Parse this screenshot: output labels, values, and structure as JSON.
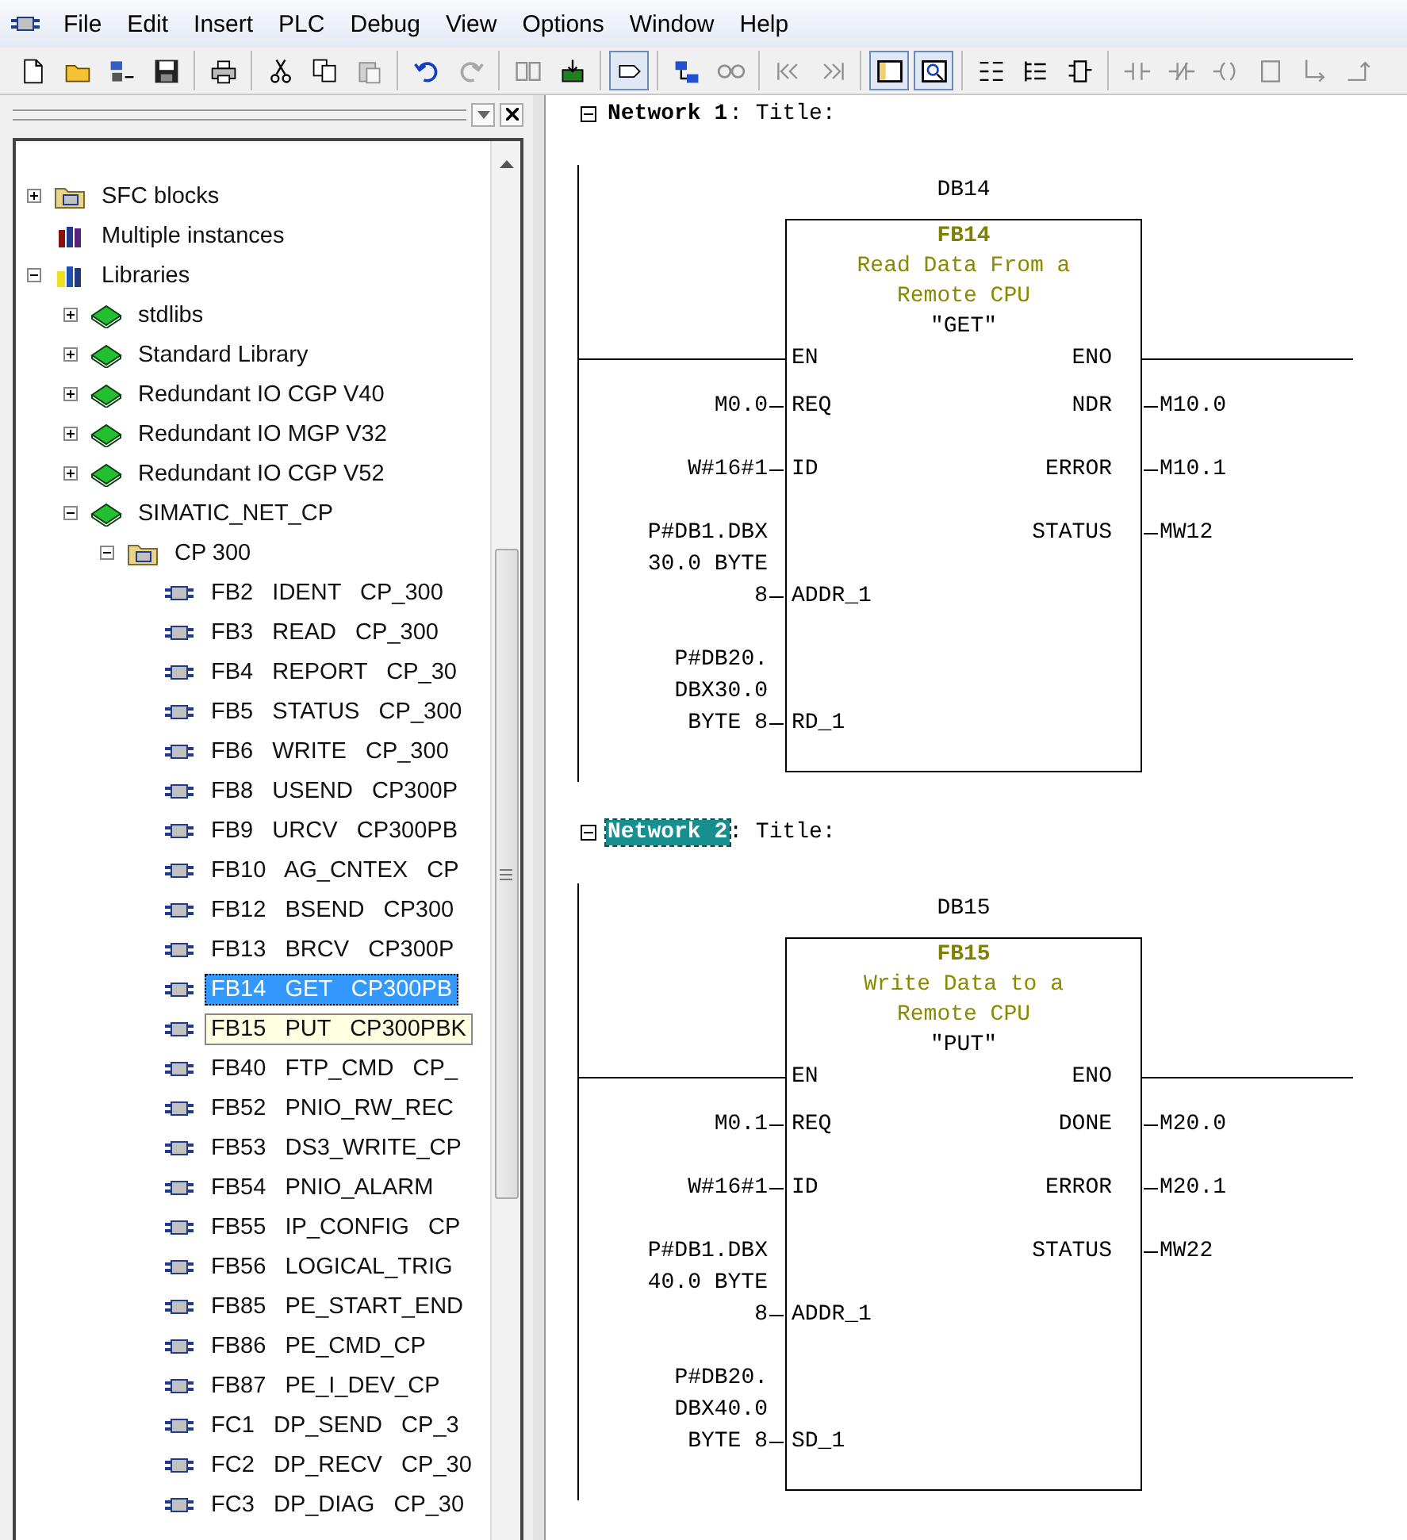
{
  "menu_bar": {
    "items": [
      "File",
      "Edit",
      "Insert",
      "PLC",
      "Debug",
      "View",
      "Options",
      "Window",
      "Help"
    ]
  },
  "toolbar": {
    "groups": [
      [
        {
          "kind": "new",
          "disabled": false,
          "pressed": false
        },
        {
          "kind": "open",
          "disabled": false,
          "pressed": false
        },
        {
          "kind": "nodes",
          "disabled": false,
          "pressed": false
        },
        {
          "kind": "save",
          "disabled": false,
          "pressed": false
        }
      ],
      [
        {
          "kind": "print",
          "disabled": false,
          "pressed": false
        }
      ],
      [
        {
          "kind": "cut",
          "disabled": false,
          "pressed": false
        },
        {
          "kind": "copy",
          "disabled": false,
          "pressed": false
        },
        {
          "kind": "paste",
          "disabled": true,
          "pressed": false
        }
      ],
      [
        {
          "kind": "undo",
          "disabled": false,
          "pressed": false
        },
        {
          "kind": "redo",
          "disabled": true,
          "pressed": false
        }
      ],
      [
        {
          "kind": "compile",
          "disabled": true,
          "pressed": false
        },
        {
          "kind": "download",
          "disabled": false,
          "pressed": false
        }
      ],
      [
        {
          "kind": "monitor",
          "disabled": false,
          "pressed": true
        }
      ],
      [
        {
          "kind": "network",
          "disabled": false,
          "pressed": false
        },
        {
          "kind": "glasses",
          "disabled": true,
          "pressed": false
        }
      ],
      [
        {
          "kind": "prev",
          "disabled": true,
          "pressed": false
        },
        {
          "kind": "next",
          "disabled": true,
          "pressed": false
        }
      ],
      [
        {
          "kind": "overview",
          "disabled": false,
          "pressed": true
        },
        {
          "kind": "details",
          "disabled": false,
          "pressed": true
        }
      ],
      [
        {
          "kind": "ladder",
          "disabled": false,
          "pressed": false
        },
        {
          "kind": "stl",
          "disabled": false,
          "pressed": false
        },
        {
          "kind": "fbd",
          "disabled": false,
          "pressed": false
        }
      ],
      [
        {
          "kind": "contact_no",
          "disabled": true,
          "pressed": false
        },
        {
          "kind": "contact_nc",
          "disabled": true,
          "pressed": false
        },
        {
          "kind": "coil",
          "disabled": true,
          "pressed": false
        },
        {
          "kind": "box",
          "disabled": true,
          "pressed": false
        },
        {
          "kind": "branch_open",
          "disabled": true,
          "pressed": false
        },
        {
          "kind": "branch_close",
          "disabled": true,
          "pressed": false
        }
      ]
    ]
  },
  "tree": {
    "items": [
      {
        "label": "SFC blocks",
        "kind": "folder",
        "expanded": false,
        "selected": false
      },
      {
        "label": "Multiple instances",
        "kind": "instances",
        "selected": false
      },
      {
        "label": "Libraries",
        "kind": "libraries",
        "expanded": true,
        "selected": false,
        "children": [
          {
            "label": "stdlibs",
            "kind": "library",
            "expanded": false,
            "selected": false
          },
          {
            "label": "Standard Library",
            "kind": "library",
            "expanded": false,
            "selected": false
          },
          {
            "label": "Redundant IO CGP V40",
            "kind": "library",
            "expanded": false,
            "selected": false
          },
          {
            "label": "Redundant IO MGP V32",
            "kind": "library",
            "expanded": false,
            "selected": false
          },
          {
            "label": "Redundant IO CGP V52",
            "kind": "library",
            "expanded": false,
            "selected": false
          },
          {
            "label": "SIMATIC_NET_CP",
            "kind": "library",
            "expanded": true,
            "selected": false,
            "children": [
              {
                "label": "CP 300",
                "kind": "folder",
                "expanded": true,
                "selected": false,
                "children": [
                  {
                    "label": "FB2   IDENT   CP_300",
                    "kind": "block",
                    "selected": false
                  },
                  {
                    "label": "FB3   READ   CP_300",
                    "kind": "block",
                    "selected": false
                  },
                  {
                    "label": "FB4   REPORT   CP_30",
                    "kind": "block",
                    "selected": false
                  },
                  {
                    "label": "FB5   STATUS   CP_300",
                    "kind": "block",
                    "selected": false
                  },
                  {
                    "label": "FB6   WRITE   CP_300",
                    "kind": "block",
                    "selected": false
                  },
                  {
                    "label": "FB8   USEND   CP300P",
                    "kind": "block",
                    "selected": false
                  },
                  {
                    "label": "FB9   URCV   CP300PB",
                    "kind": "block",
                    "selected": false
                  },
                  {
                    "label": "FB10   AG_CNTEX   CP",
                    "kind": "block",
                    "selected": false
                  },
                  {
                    "label": "FB12   BSEND   CP300",
                    "kind": "block",
                    "selected": false
                  },
                  {
                    "label": "FB13   BRCV   CP300P",
                    "kind": "block",
                    "selected": false
                  },
                  {
                    "label": "FB14   GET   CP300PB",
                    "kind": "block",
                    "selected": true
                  },
                  {
                    "label": "FB15   PUT   CP300PBK",
                    "kind": "block",
                    "selected": false,
                    "tooltip": true
                  },
                  {
                    "label": "FB40   FTP_CMD   CP_",
                    "kind": "block",
                    "selected": false
                  },
                  {
                    "label": "FB52   PNIO_RW_REC",
                    "kind": "block",
                    "selected": false
                  },
                  {
                    "label": "FB53   DS3_WRITE_CP",
                    "kind": "block",
                    "selected": false
                  },
                  {
                    "label": "FB54   PNIO_ALARM",
                    "kind": "block",
                    "selected": false
                  },
                  {
                    "label": "FB55   IP_CONFIG   CP",
                    "kind": "block",
                    "selected": false
                  },
                  {
                    "label": "FB56   LOGICAL_TRIG",
                    "kind": "block",
                    "selected": false
                  },
                  {
                    "label": "FB85   PE_START_END",
                    "kind": "block",
                    "selected": false
                  },
                  {
                    "label": "FB86   PE_CMD_CP",
                    "kind": "block",
                    "selected": false
                  },
                  {
                    "label": "FB87   PE_I_DEV_CP",
                    "kind": "block",
                    "selected": false
                  },
                  {
                    "label": "FC1   DP_SEND   CP_3",
                    "kind": "block",
                    "selected": false
                  },
                  {
                    "label": "FC2   DP_RECV   CP_30",
                    "kind": "block",
                    "selected": false
                  },
                  {
                    "label": "FC3   DP_DIAG   CP_30",
                    "kind": "block",
                    "selected": false
                  }
                ]
              }
            ]
          }
        ]
      }
    ]
  },
  "editor": {
    "networks": [
      {
        "label": "Network 1",
        "title": ": Title:",
        "selected": false,
        "instance": "DB14",
        "block": {
          "name": "FB14",
          "description": "Read Data From a Remote CPU",
          "symbol": "″GET″",
          "rows": [
            {
              "kind": "power",
              "in_pin": "EN",
              "out_pin": "ENO"
            },
            {
              "kind": "signal",
              "input": "M0.0",
              "in_pin": "REQ",
              "out_pin": "NDR",
              "output": "M10.0"
            },
            {
              "kind": "signal",
              "input": "W#16#1",
              "in_pin": "ID",
              "out_pin": "ERROR",
              "output": "M10.1"
            },
            {
              "kind": "signal",
              "out_pin": "STATUS",
              "output": "MW12"
            },
            {
              "kind": "signal",
              "input": "P#DB1.DBX\n30.0 BYTE\n8",
              "in_pin": "ADDR_1"
            },
            {
              "kind": "blank"
            },
            {
              "kind": "signal",
              "input": "P#DB20.\nDBX30.0\nBYTE 8",
              "in_pin": "RD_1"
            }
          ]
        }
      },
      {
        "label": "Network 2",
        "title": ": Title:",
        "selected": true,
        "instance": "DB15",
        "block": {
          "name": "FB15",
          "description": "Write Data to a Remote CPU",
          "symbol": "″PUT″",
          "rows": [
            {
              "kind": "power",
              "in_pin": "EN",
              "out_pin": "ENO"
            },
            {
              "kind": "signal",
              "input": "M0.1",
              "in_pin": "REQ",
              "out_pin": "DONE",
              "output": "M20.0"
            },
            {
              "kind": "signal",
              "input": "W#16#1",
              "in_pin": "ID",
              "out_pin": "ERROR",
              "output": "M20.1"
            },
            {
              "kind": "signal",
              "out_pin": "STATUS",
              "output": "MW22"
            },
            {
              "kind": "signal",
              "input": "P#DB1.DBX\n40.0 BYTE\n8",
              "in_pin": "ADDR_1"
            },
            {
              "kind": "blank"
            },
            {
              "kind": "signal",
              "input": "P#DB20.\nDBX40.0\nBYTE 8",
              "in_pin": "SD_1"
            }
          ]
        }
      }
    ]
  }
}
